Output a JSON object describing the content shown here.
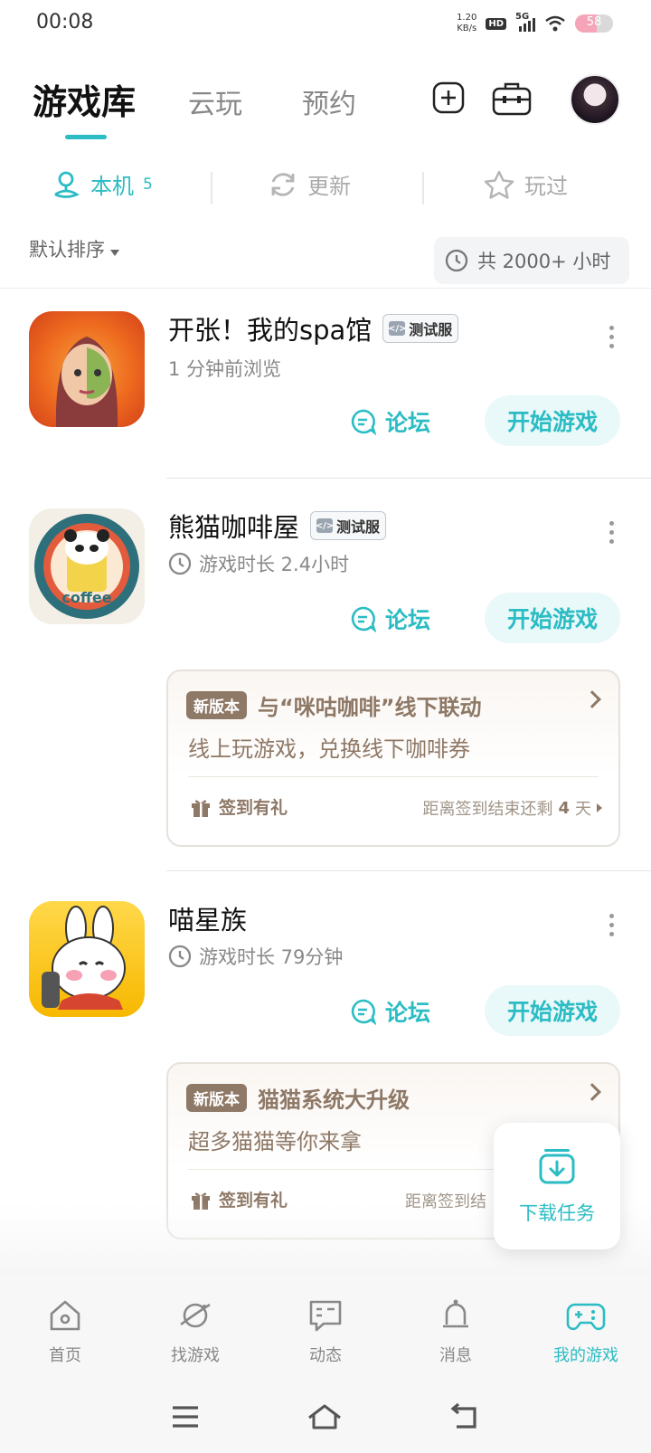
{
  "status_bar": {
    "time": "00:08",
    "net_speed_value": "1.20",
    "net_speed_unit": "KB/s",
    "hd": "HD",
    "network": "5G",
    "battery": "58",
    "battery_level": 0.58
  },
  "header": {
    "tabs": [
      {
        "label": "游戏库",
        "active": true
      },
      {
        "label": "云玩",
        "active": false
      },
      {
        "label": "预约",
        "active": false
      }
    ]
  },
  "sub_tabs": [
    {
      "label": "本机",
      "count": "5",
      "active": true,
      "icon": "user-location-icon"
    },
    {
      "label": "更新",
      "active": false,
      "icon": "refresh-icon"
    },
    {
      "label": "玩过",
      "active": false,
      "icon": "star-icon"
    }
  ],
  "sort": {
    "label": "默认排序"
  },
  "total_hours": "共 2000+ 小时",
  "games": [
    {
      "title": "开张！我的spa馆",
      "badge": "测试服",
      "subtitle": "1 分钟前浏览",
      "forum_label": "论坛",
      "play_label": "开始游戏"
    },
    {
      "title": "熊猫咖啡屋",
      "badge": "测试服",
      "subtitle": "游戏时长 2.4小时",
      "forum_label": "论坛",
      "play_label": "开始游戏",
      "icon_text": "coffee",
      "promo": {
        "tag": "新版本",
        "title": "与“咪咕咖啡”线下联动",
        "desc": "线上玩游戏，兑换线下咖啡券",
        "gift_label": "签到有礼",
        "remain_prefix": "距离签到结束还剩",
        "remain_days": "4",
        "remain_suffix": "天"
      }
    },
    {
      "title": "喵星族",
      "subtitle": "游戏时长 79分钟",
      "forum_label": "论坛",
      "play_label": "开始游戏",
      "promo": {
        "tag": "新版本",
        "title": "猫猫系统大升级",
        "desc": "超多猫猫等你来拿",
        "gift_label": "签到有礼",
        "remain_prefix": "距离签到结"
      }
    }
  ],
  "float_download": {
    "label": "下载任务"
  },
  "bottom_nav": [
    {
      "label": "首页",
      "icon": "home-icon",
      "active": false
    },
    {
      "label": "找游戏",
      "icon": "planet-icon",
      "active": false
    },
    {
      "label": "动态",
      "icon": "chat-icon",
      "active": false
    },
    {
      "label": "消息",
      "icon": "bell-icon",
      "active": false
    },
    {
      "label": "我的游戏",
      "icon": "gamepad-icon",
      "active": true
    }
  ],
  "colors": {
    "accent": "#2bbcc4",
    "promo_brown": "#8e7866"
  }
}
